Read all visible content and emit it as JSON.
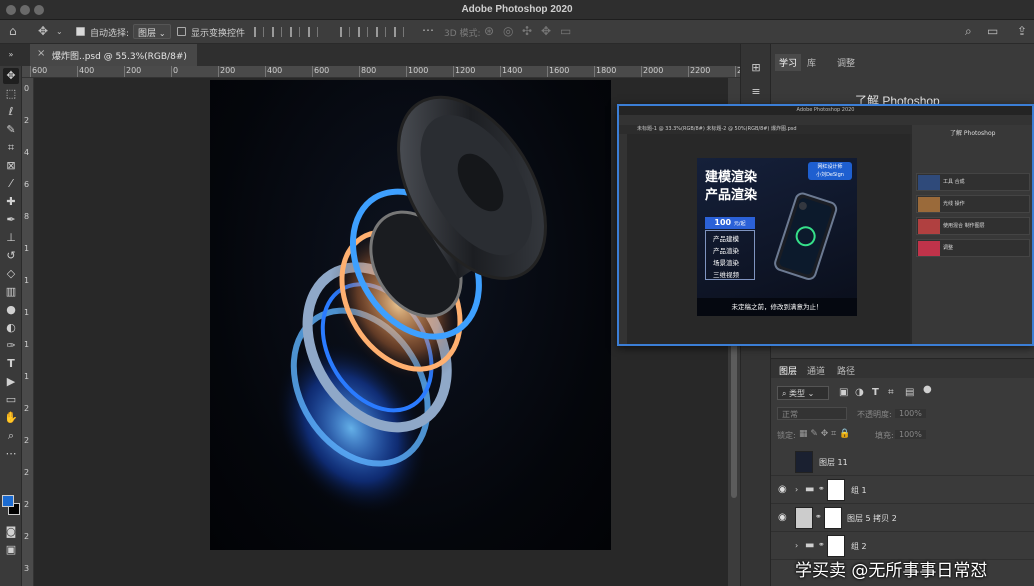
{
  "window": {
    "title": "Adobe Photoshop 2020"
  },
  "options_bar": {
    "auto_select_label": "自动选择:",
    "auto_select_target": "图层",
    "show_transform_label": "显示变换控件",
    "mode_3d_label": "3D 模式:"
  },
  "document": {
    "tab_label": "爆炸图..psd @ 55.3%(RGB/8#)"
  },
  "ruler": {
    "top_ticks": [
      "600",
      "400",
      "200",
      "0",
      "200",
      "400",
      "600",
      "800",
      "1000",
      "1200",
      "1400",
      "1600",
      "1800",
      "2000",
      "2200",
      "2400"
    ],
    "left_ticks": [
      "0",
      "2",
      "4",
      "6",
      "8",
      "1",
      "1",
      "1",
      "1",
      "1",
      "2",
      "2",
      "2",
      "2",
      "2",
      "3"
    ]
  },
  "right_panel": {
    "tabs": [
      "学习",
      "库",
      "调整"
    ],
    "learn_title": "了解 Photoshop",
    "layers_tabs": [
      "图层",
      "通道",
      "路径"
    ],
    "filter_kind": "类型",
    "blend_mode": "正常",
    "opacity_label": "不透明度:",
    "opacity_value": "100%",
    "lock_label": "锁定:",
    "fill_label": "填充:",
    "fill_value": "100%",
    "layers": [
      {
        "name": "图层 11",
        "visible": false
      },
      {
        "name": "组 1",
        "visible": true
      },
      {
        "name": "图层 5 拷贝 2",
        "visible": true
      },
      {
        "name": "组 2",
        "visible": false
      }
    ]
  },
  "overlay": {
    "title": "Adobe Photoshop 2020",
    "tab_text": "未标题-1 @ 33.3%(RGB/8#)   未标题-2 @ 50%(RGB/8#)   爆炸图.psd",
    "panel_title": "了解 Photoshop",
    "design": {
      "headline_1": "建模渲染",
      "headline_2": "产品渲染",
      "badge_line_1": "网红设计师",
      "badge_line_2": "小刘DeSign",
      "price_value": "100",
      "price_unit": "元/起",
      "services": [
        "产品建模",
        "产品渲染",
        "场景渲染",
        "三维视频"
      ],
      "footer": "未定稿之前，修改到满意为止！"
    },
    "tutorials": [
      "工具 合成",
      "光线 操作",
      "使用混合 制作图层",
      "调整"
    ]
  },
  "watermark": "学买卖 @无所事事日常怼",
  "colors": {
    "foreground": "#1b6bd1",
    "background": "#000000",
    "accent": "#3b7ed6"
  }
}
